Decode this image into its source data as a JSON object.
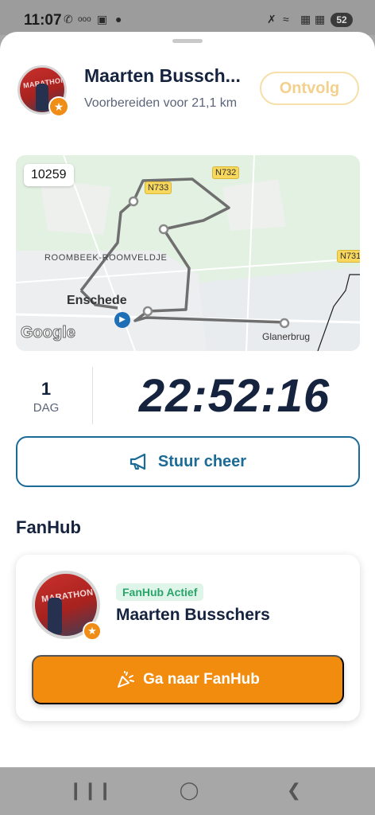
{
  "status_bar": {
    "time": "11:07",
    "icons": [
      "whatsapp-icon",
      "news-icon",
      "mail-icon",
      "dot-icon",
      "mute-icon",
      "wifi-icon",
      "signal-icon",
      "signal-icon"
    ],
    "battery": "52"
  },
  "header": {
    "name": "Maarten Bussch...",
    "subtitle": "Voorbereiden voor 21,1 km",
    "unfollow_label": "Ontvolg",
    "avatar_text": "MARATHON"
  },
  "map": {
    "bib_number": "10259",
    "roads": [
      "N733",
      "N732",
      "N731"
    ],
    "district": "ROOMBEEK-ROOMVELDJE",
    "city": "Enschede",
    "town": "Glanerbrug",
    "logo": "Google"
  },
  "timer": {
    "days": "1",
    "days_label": "DAG",
    "elapsed": "22:52:16"
  },
  "cheer": {
    "label": "Stuur cheer",
    "icon": "megaphone-icon"
  },
  "fanhub": {
    "section_title": "FanHub",
    "status_badge": "FanHub Actief",
    "name": "Maarten Busschers",
    "button_label": "Ga naar FanHub",
    "button_icon": "party-popper-icon",
    "avatar_text": "MARATHON"
  },
  "colors": {
    "brand_navy": "#15233f",
    "cheer_blue": "#1b6b96",
    "fanhub_orange": "#f28c0f",
    "active_green": "#2aa56a",
    "unfollow_outline": "#f6dfa8"
  }
}
